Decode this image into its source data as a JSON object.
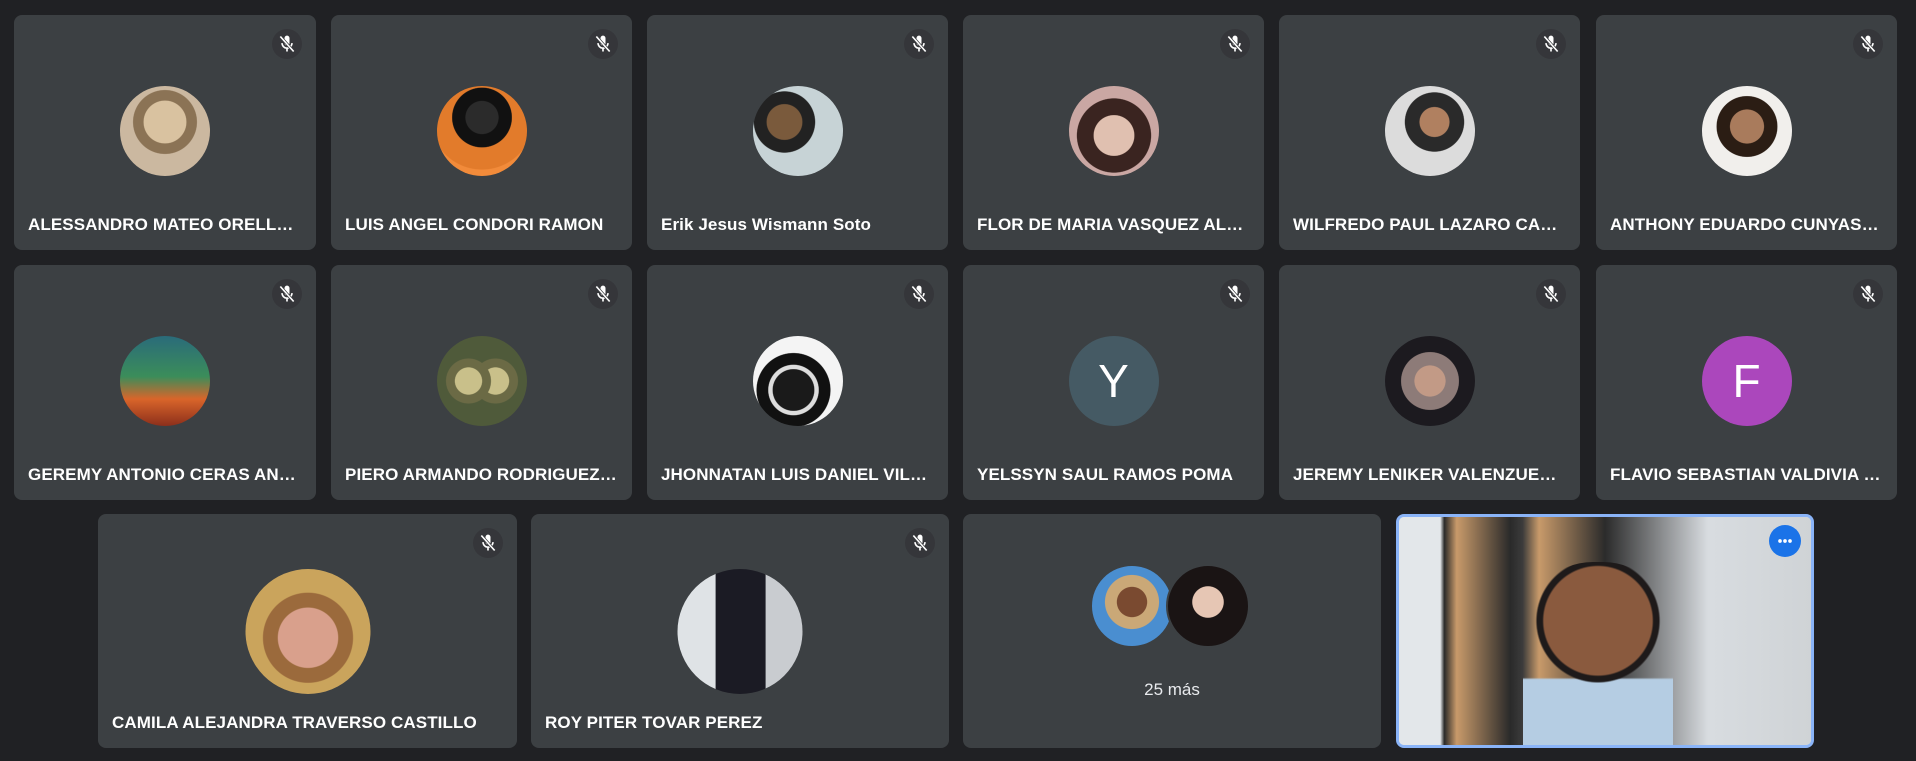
{
  "participants": [
    {
      "name": "ALESSANDRO MATEO ORELLAN...",
      "avatar": "pug-dog-photo",
      "muted": true
    },
    {
      "name": "LUIS ANGEL CONDORI RAMON",
      "avatar": "masked-person-photo",
      "muted": true
    },
    {
      "name": "Erik Jesus Wismann Soto",
      "avatar": "sunglasses-selfie-photo",
      "muted": true
    },
    {
      "name": "FLOR DE MARIA VASQUEZ ALFA...",
      "avatar": "girl-portrait-photo",
      "muted": true
    },
    {
      "name": "WILFREDO PAUL LAZARO CARPIO",
      "avatar": "young-man-photo",
      "muted": true
    },
    {
      "name": "ANTHONY EDUARDO CUNYAS L...",
      "avatar": "boy-portrait-photo",
      "muted": true
    },
    {
      "name": "GEREMY ANTONIO CERAS ANTE...",
      "avatar": "autumn-path-photo",
      "muted": true
    },
    {
      "name": "PIERO ARMANDO RODRIGUEZ ...",
      "avatar": "owls-photo",
      "muted": true
    },
    {
      "name": "JHONNATAN LUIS DANIEL VILCA...",
      "avatar": "drum-kit-photo",
      "muted": true
    },
    {
      "name": "YELSSYN SAUL RAMOS POMA",
      "avatar_letter": "Y",
      "avatar_color": "#455a64",
      "muted": true
    },
    {
      "name": "JEREMY LENIKER VALENZUELA F...",
      "avatar": "hooded-person-photo",
      "muted": true
    },
    {
      "name": "FLAVIO SEBASTIAN VALDIVIA ES...",
      "avatar_letter": "F",
      "avatar_color": "#ab47bc",
      "muted": true
    },
    {
      "name": "CAMILA ALEJANDRA TRAVERSO CASTILLO",
      "avatar": "girl-hat-photo",
      "muted": true
    },
    {
      "name": "ROY PITER TOVAR PEREZ",
      "avatar": "man-suit-photo",
      "muted": true
    }
  ],
  "more": {
    "label": "25 más",
    "avatars": [
      "woman-hat-photo",
      "smiling-girl-photo"
    ]
  },
  "self_view": {
    "icon": "more-options-icon",
    "highlight_color": "#8ab4f8"
  }
}
